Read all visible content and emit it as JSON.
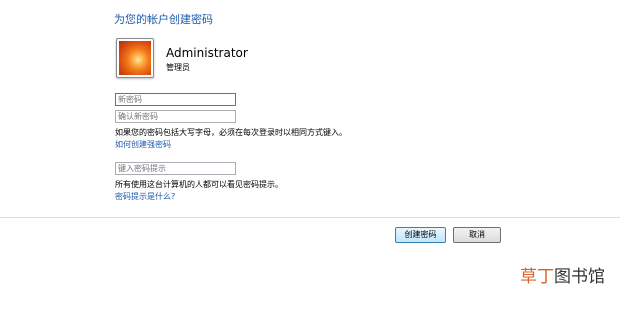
{
  "header": {
    "title": "为您的帐户创建密码"
  },
  "account": {
    "name": "Administrator",
    "role": "管理员"
  },
  "form": {
    "new_password_placeholder": "新密码",
    "confirm_password_placeholder": "确认新密码",
    "caps_note": "如果您的密码包括大写字母，必须在每次登录时以相同方式键入。",
    "strong_password_link": "如何创建强密码",
    "hint_placeholder": "键入密码提示",
    "hint_note": "所有使用这台计算机的人都可以看见密码提示。",
    "hint_help_link": "密码提示是什么?"
  },
  "buttons": {
    "create": "创建密码",
    "cancel": "取消"
  },
  "watermark": {
    "accent": "草丁",
    "rest": "图书馆"
  }
}
